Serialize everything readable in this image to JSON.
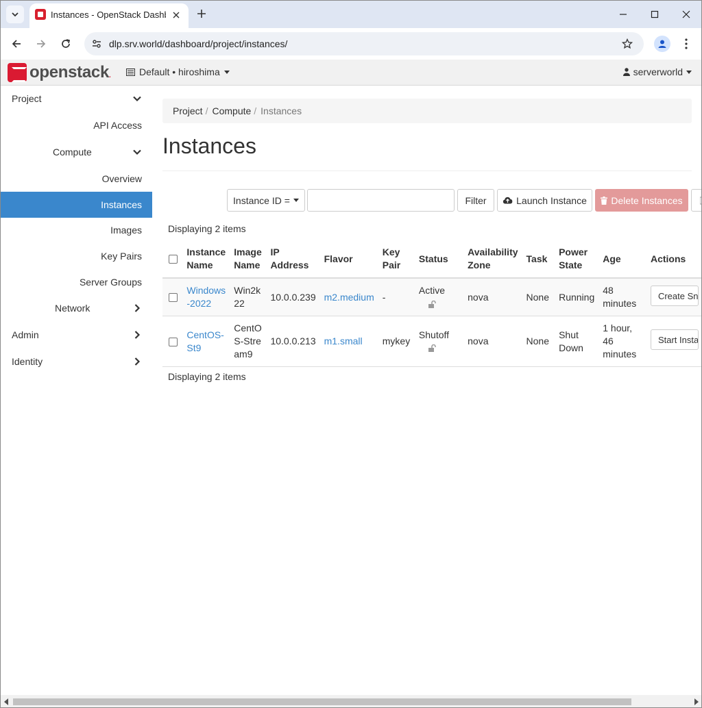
{
  "browser": {
    "tab_title": "Instances - OpenStack Dashboard",
    "url": "dlp.srv.world/dashboard/project/instances/"
  },
  "header": {
    "logo_text": "openstack",
    "project": "Default • hiroshima",
    "user": "serverworld"
  },
  "sidebar": {
    "project": "Project",
    "api_access": "API Access",
    "compute": "Compute",
    "overview": "Overview",
    "instances": "Instances",
    "images": "Images",
    "key_pairs": "Key Pairs",
    "server_groups": "Server Groups",
    "network": "Network",
    "admin": "Admin",
    "identity": "Identity"
  },
  "breadcrumb": [
    "Project",
    "Compute",
    "Instances"
  ],
  "page_title": "Instances",
  "actions": {
    "filter_field": "Instance ID =",
    "filter": "Filter",
    "launch": "Launch Instance",
    "delete": "Delete Instances"
  },
  "count_text": "Displaying 2 items",
  "table": {
    "headers": {
      "name": [
        "Instance",
        "Name"
      ],
      "image": [
        "Image",
        "Name"
      ],
      "ip": [
        "IP",
        "Address"
      ],
      "flavor": "Flavor",
      "key": [
        "Key",
        "Pair"
      ],
      "status": "Status",
      "zone": [
        "Availability",
        "Zone"
      ],
      "task": "Task",
      "power": [
        "Power",
        "State"
      ],
      "age": "Age",
      "actions": "Actions"
    },
    "rows": [
      {
        "name": [
          "Windows",
          "-2022"
        ],
        "image": [
          "Win2k",
          "22"
        ],
        "ip": "10.0.0.239",
        "flavor": "m2.medium",
        "key": "-",
        "status": "Active",
        "zone": "nova",
        "task": "None",
        "power": [
          "Running"
        ],
        "age": [
          "48 minutes"
        ],
        "action": "Create Snapshot"
      },
      {
        "name": [
          "CentOS-",
          "St9"
        ],
        "image": [
          "CentO",
          "S-Stre",
          "am9"
        ],
        "ip": "10.0.0.213",
        "flavor": "m1.small",
        "key": "mykey",
        "status": "Shutoff",
        "zone": "nova",
        "task": "None",
        "power": [
          "Shut",
          "Down"
        ],
        "age": [
          "1 hour,",
          "46 minutes"
        ],
        "action": "Start Instance"
      }
    ]
  },
  "colors": {
    "accent": "#3a87cc",
    "danger": "#e39a9a",
    "brand": "#da1a32"
  }
}
